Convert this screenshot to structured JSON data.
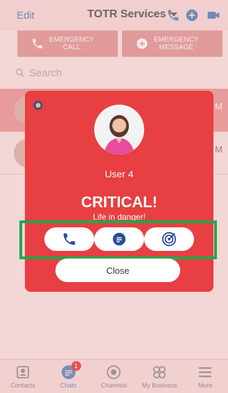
{
  "header": {
    "edit_label": "Edit",
    "title": "TOTR Services",
    "icons": [
      "phone-icon",
      "add-icon",
      "video-icon"
    ]
  },
  "emergency": {
    "call_label_1": "EMERGENCY",
    "call_label_2": "CALL",
    "message_label_1": "EMERGENCY",
    "message_label_2": "MESSAGE"
  },
  "search": {
    "placeholder": "Search"
  },
  "chat_list": [
    {
      "time": "M"
    },
    {
      "time": "M"
    }
  ],
  "alert": {
    "user_name": "User 4",
    "level": "CRITICAL!",
    "message": "Life in danger!",
    "actions": [
      "phone-icon",
      "chat-icon",
      "target-icon"
    ],
    "close_label": "Close",
    "accent_color": "#e73f42",
    "highlight_color": "#1fa84a"
  },
  "tabs": [
    {
      "label": "Contacts",
      "icon": "contacts-icon"
    },
    {
      "label": "Chats",
      "icon": "chats-icon",
      "badge": "1"
    },
    {
      "label": "Channels",
      "icon": "channels-icon"
    },
    {
      "label": "My Business",
      "icon": "business-icon"
    },
    {
      "label": "More",
      "icon": "menu-icon"
    }
  ]
}
